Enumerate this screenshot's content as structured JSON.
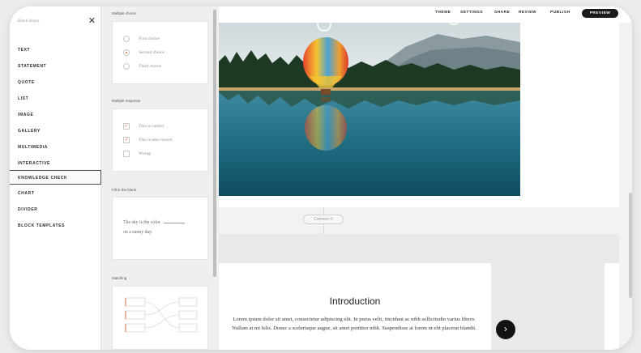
{
  "library": {
    "title": "Block library",
    "items": [
      {
        "label": "TEXT"
      },
      {
        "label": "STATEMENT"
      },
      {
        "label": "QUOTE"
      },
      {
        "label": "LIST"
      },
      {
        "label": "IMAGE"
      },
      {
        "label": "GALLERY"
      },
      {
        "label": "MULTIMEDIA"
      },
      {
        "label": "INTERACTIVE"
      },
      {
        "label": "KNOWLEDGE CHECK"
      },
      {
        "label": "CHART"
      },
      {
        "label": "DIVIDER"
      },
      {
        "label": "BLOCK TEMPLATES"
      }
    ],
    "active_item": "KNOWLEDGE CHECK"
  },
  "knowledge_check": {
    "multiple_choice": {
      "label": "Multiple choice",
      "options": [
        "First choice",
        "Second choice",
        "Third choice"
      ],
      "selected": "Second choice"
    },
    "multiple_response": {
      "label": "Multiple response",
      "options": [
        "This is correct",
        "This is also correct",
        "Wrong"
      ],
      "checked": [
        "This is correct",
        "This is also correct"
      ]
    },
    "fill_in_blank": {
      "label": "Fill in the blank",
      "line1": "The sky is the color",
      "line2": "on a sunny day."
    },
    "matching": {
      "label": "Matching"
    }
  },
  "topbar": {
    "nav": [
      "THEME",
      "SETTINGS",
      "SHARE",
      "REVIEW",
      "PUBLISH"
    ],
    "preview_label": "PREVIEW"
  },
  "connect_label": "Connect",
  "intro": {
    "title": "Introduction",
    "body": "Lorem ipsum dolor sit amet, consectetur adipiscing elit. In purus velit, tincidunt ac nibh sollicitudin varius libero. Nullam at mi felis. Donec a scelerisque augue, sit amet porttitor nibh. Suspendisse at lorem ut elit placerat blandit."
  },
  "colors": {
    "accent": "#e46a3e",
    "dark": "#1a1a1a"
  }
}
